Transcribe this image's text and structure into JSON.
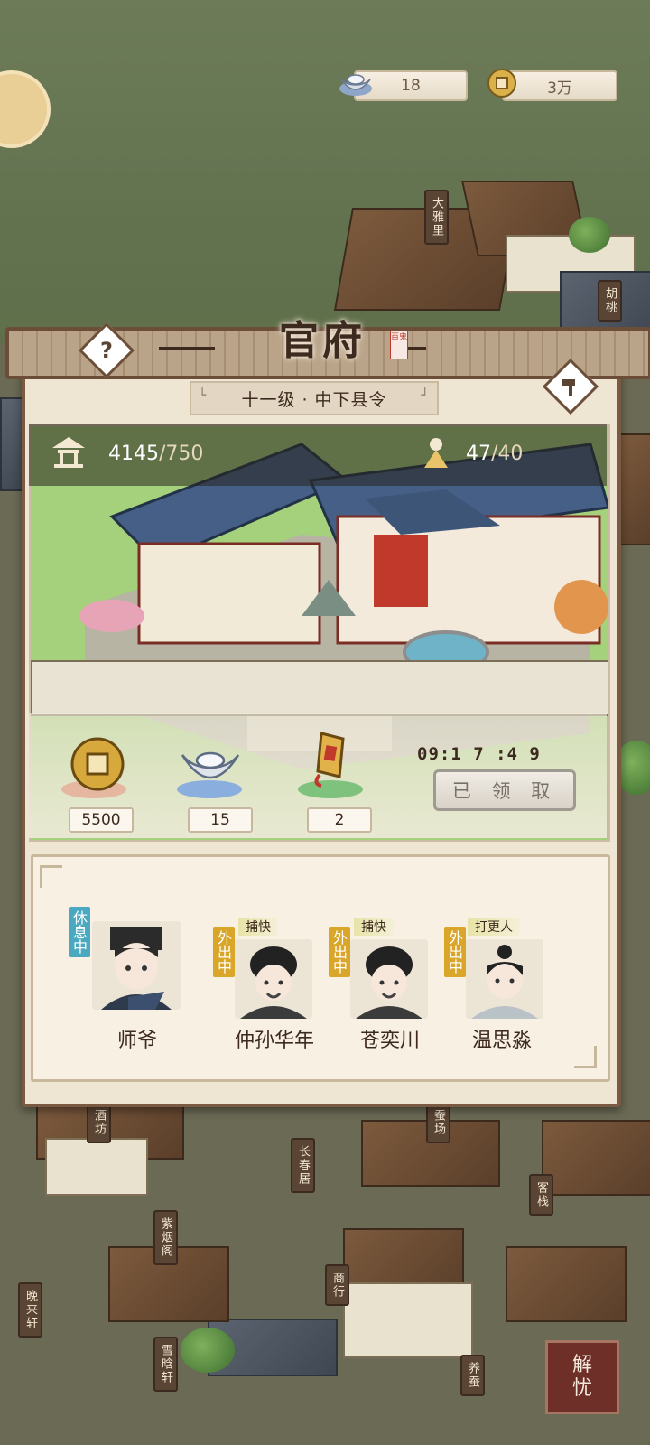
{
  "currency": {
    "silver": "18",
    "coins": "3万"
  },
  "panel": {
    "title": "官府",
    "seal": "百鬼",
    "level": "十一级 · 中下县令",
    "help_label": "?",
    "stats": {
      "prosperity_value": "4145",
      "prosperity_max": "/750",
      "population_value": "47",
      "population_max": "/40"
    },
    "rewards": [
      {
        "icon": "copper-coin-icon",
        "value": "5500"
      },
      {
        "icon": "silver-ingot-icon",
        "value": "15"
      },
      {
        "icon": "order-token-icon",
        "value": "2"
      }
    ],
    "timer": "09:1  7  :4  9",
    "claimed_label": "已 领 取"
  },
  "staff": [
    {
      "name": "师爷",
      "status": "休息中",
      "role": ""
    },
    {
      "name": "仲孙华年",
      "status": "外出中",
      "role": "捕快"
    },
    {
      "name": "苍奕川",
      "status": "外出中",
      "role": "捕快"
    },
    {
      "name": "温思淼",
      "status": "外出中",
      "role": "打更人"
    }
  ],
  "map_signs": [
    "大雅里",
    "胡桃",
    "酒坊",
    "长春居",
    "蚕场",
    "客栈",
    "紫烟阁",
    "商行",
    "晚来轩",
    "雪晗轩",
    "养蚕"
  ],
  "jieyou": {
    "line1": "解",
    "line2": "忧"
  }
}
